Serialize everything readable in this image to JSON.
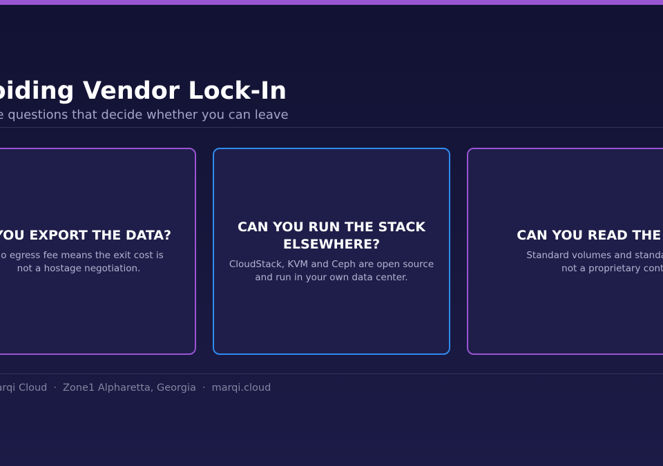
{
  "slide": {
    "title": "Avoiding Vendor Lock-In",
    "subtitle": "Three questions that decide whether you can leave",
    "accent_color": "#9a55d4",
    "cards": [
      {
        "heading": "CAN YOU EXPORT THE DATA?",
        "text": "No egress fee means the exit cost is not a hostage negotiation.",
        "border_color": "#9a55d4"
      },
      {
        "heading": "CAN YOU RUN THE STACK ELSEWHERE?",
        "text": "CloudStack, KVM and Ceph are open source and run in your own data center.",
        "border_color": "#2f8cef"
      },
      {
        "heading": "CAN YOU READ THE FORMAT?",
        "text": "Standard volumes and standard protocols, not a proprietary container.",
        "border_color": "#9a55d4"
      }
    ],
    "footer": {
      "brand": "Marqi Cloud",
      "location": "Zone1 Alpharetta, Georgia",
      "website": "marqi.cloud",
      "separator": "·"
    }
  }
}
